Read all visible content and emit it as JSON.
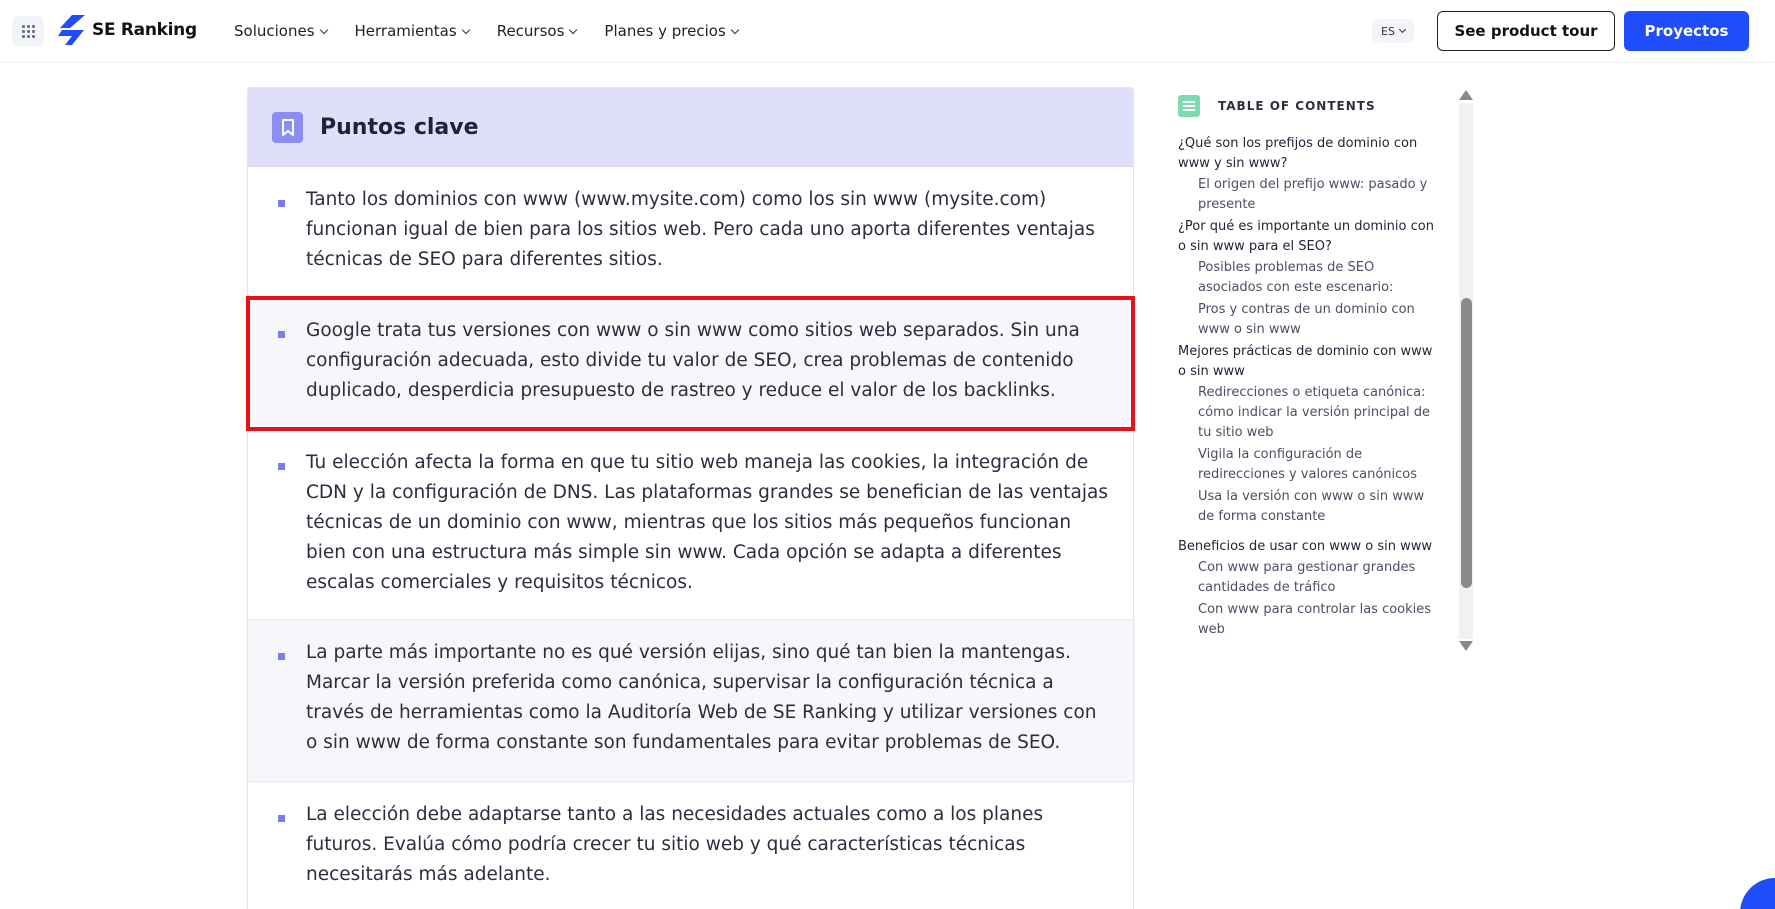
{
  "header": {
    "logo_text": "SE Ranking",
    "nav": [
      "Soluciones",
      "Herramientas",
      "Recursos",
      "Planes y precios"
    ],
    "lang": "ES",
    "tour_button": "See product tour",
    "projects_button": "Proyectos",
    "colors": {
      "primary": "#1f4dfb"
    }
  },
  "key_points": {
    "title": "Puntos clave",
    "items": [
      "Tanto los dominios con www (www.mysite.com) como los sin www (mysite.com) funcionan igual de bien para los sitios web. Pero cada uno aporta diferentes ventajas técnicas de SEO para diferentes sitios.",
      "Google trata tus versiones con www o sin www como sitios web separados. Sin una configuración adecuada, esto divide tu valor de SEO, crea problemas de contenido duplicado, desperdicia presupuesto de rastreo y reduce el valor de los backlinks.",
      "Tu elección afecta la forma en que tu sitio web maneja las cookies, la integración de CDN y la configuración de DNS. Las plataformas grandes se benefician de las ventajas técnicas de un dominio con www, mientras que los sitios más pequeños funcionan bien con una estructura más simple sin www. Cada opción se adapta a diferentes escalas comerciales y requisitos técnicos.",
      "La parte más importante no es qué versión elijas, sino qué tan bien la mantengas. Marcar la versión preferida como canónica, supervisar la configuración técnica a través de herramientas como la Auditoría Web de SE Ranking y utilizar versiones con o sin www de forma constante son fundamentales para evitar problemas de SEO.",
      "La elección debe adaptarse tanto a las necesidades actuales como a los planes futuros. Evalúa cómo podría crecer tu sitio web y qué características técnicas necesitarás más adelante."
    ],
    "highlight_color": "#e8101a"
  },
  "toc": {
    "title": "TABLE OF CONTENTS",
    "items": [
      {
        "level": 1,
        "text": "¿Qué son los prefijos de dominio con www y sin www?"
      },
      {
        "level": 2,
        "text": "El origen del prefijo www: pasado y presente"
      },
      {
        "level": 1,
        "text": "¿Por qué es importante un dominio con o sin www para el SEO?"
      },
      {
        "level": 2,
        "text": "Posibles problemas de SEO asociados con este escenario:"
      },
      {
        "level": 2,
        "text": "Pros y contras de un dominio con www o sin www"
      },
      {
        "level": 1,
        "text": "Mejores prácticas de dominio con www o sin www"
      },
      {
        "level": 2,
        "text": "Redirecciones o etiqueta canónica: cómo indicar la versión principal de tu sitio web"
      },
      {
        "level": 2,
        "text": "Vigila la configuración de redirecciones y valores canónicos"
      },
      {
        "level": 2,
        "text": "Usa la versión con www o sin www de forma constante"
      },
      {
        "level": 1,
        "text": "Beneficios de usar con www o sin www"
      },
      {
        "level": 2,
        "text": "Con www para gestionar grandes cantidades de tráfico"
      },
      {
        "level": 2,
        "text": "Con www para controlar las cookies web"
      }
    ]
  }
}
